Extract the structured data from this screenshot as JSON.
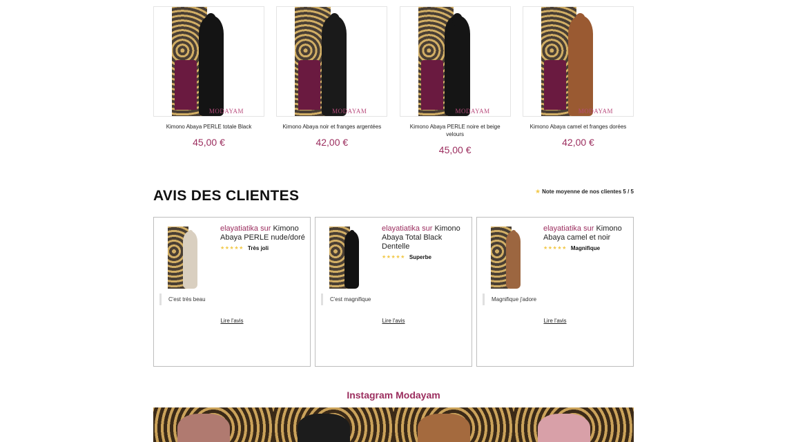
{
  "products": [
    {
      "name": "Kimono Abaya PERLE totale Black",
      "price": "45,00 €",
      "watermark": "MODAYAM",
      "dress_color": "#141414"
    },
    {
      "name": "Kimono Abaya noir et franges argentées",
      "price": "42,00 €",
      "watermark": "MODAYAM",
      "dress_color": "#1a1a1a"
    },
    {
      "name": "Kimono Abaya PERLE noire et beige velours",
      "price": "45,00 €",
      "watermark": "MODAYAM",
      "dress_color": "#151515"
    },
    {
      "name": "Kimono Abaya camel et franges dorées",
      "price": "42,00 €",
      "watermark": "MODAYAM",
      "dress_color": "#9a5a32"
    }
  ],
  "reviews_section": {
    "title": "AVIS DES CLIENTES",
    "average_note": "Note moyenne de nos clientes 5 / 5",
    "prev_arrow": "<",
    "next_arrow": ">"
  },
  "reviews": [
    {
      "author": "elayatiatika",
      "joiner": "sur",
      "product": "Kimono Abaya PERLE nude/doré",
      "rating": 5,
      "stars": "★★★★★",
      "verdict": "Très joli",
      "comment": "C'est très beau",
      "read_link": "Lire l'avis",
      "dress_color": "#d9cfc0"
    },
    {
      "author": "elayatiatika",
      "joiner": "sur",
      "product": "Kimono Abaya Total Black Dentelle",
      "rating": 5,
      "stars": "★★★★★",
      "verdict": "Superbe",
      "comment": "C'est magnifique",
      "read_link": "Lire l'avis",
      "dress_color": "#121212"
    },
    {
      "author": "elayatiatika",
      "joiner": "sur",
      "product": "Kimono Abaya camel et noir",
      "rating": 5,
      "stars": "★★★★★",
      "verdict": "Magnifique",
      "comment": "Magnifique j'adore",
      "read_link": "Lire l'avis",
      "dress_color": "#9c6640"
    }
  ],
  "instagram": {
    "title": "Instagram Modayam",
    "tiles": [
      {
        "dress_color": "#b07a70"
      },
      {
        "dress_color": "#1c1c1c"
      },
      {
        "dress_color": "#a46a3e"
      },
      {
        "dress_color": "#d8a0a8"
      }
    ]
  },
  "colors": {
    "accent": "#9b2d5e",
    "star": "#f2c94c"
  }
}
